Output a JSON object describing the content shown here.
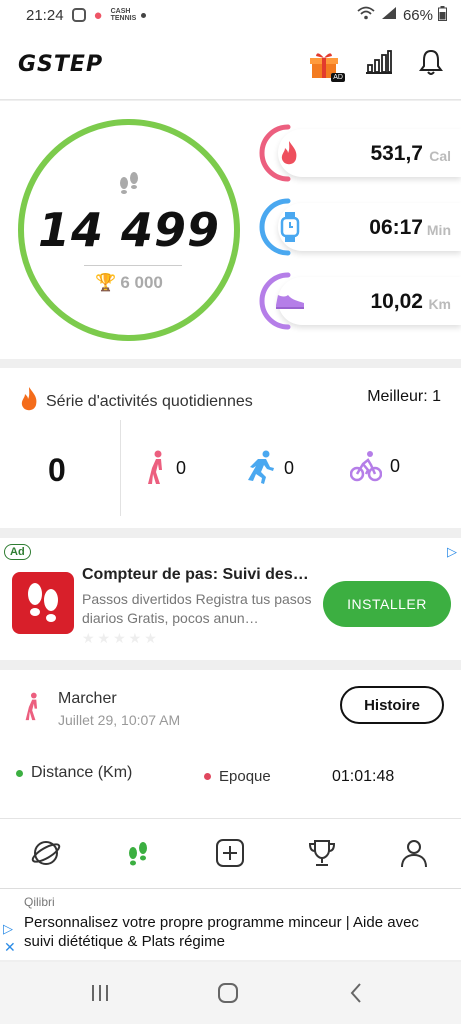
{
  "status_bar": {
    "time": "21:24",
    "cash_badge": "CASH TENNIS",
    "battery": "66%"
  },
  "header": {
    "logo": "GSTEP",
    "gift_badge": "AD",
    "icons": [
      "gift-icon",
      "bar-chart-icon",
      "bell-icon"
    ]
  },
  "steps_card": {
    "steps": "14 499",
    "goal": "6 000",
    "progress_fraction": 1.0,
    "ring_color": "#7ccb4c"
  },
  "stats": [
    {
      "value": "531,7",
      "unit": "Cal",
      "icon": "flame-icon",
      "color": "#ec5f7f"
    },
    {
      "value": "06:17",
      "unit": "Min",
      "icon": "watch-icon",
      "color": "#4aa8f0"
    },
    {
      "value": "10,02",
      "unit": "Km",
      "icon": "shoe-icon",
      "color": "#b57ee8"
    }
  ],
  "streak": {
    "title": "Série d'activités quotidiennes",
    "best": "Meilleur: 1",
    "current": "0",
    "walk": "0",
    "run": "0",
    "bike": "0"
  },
  "ad": {
    "badge": "Ad",
    "title": "Compteur de pas: Suivi des…",
    "desc": "Passos divertidos Registra tus pasos diarios Gratis, pocos anun…",
    "install": "INSTALLER"
  },
  "history": {
    "activity": "Marcher",
    "date": "Juillet 29, 10:07 AM",
    "button": "Histoire",
    "distance_label": "Distance (Km)",
    "epoch_label": "Epoque",
    "epoch_value": "01:01:48"
  },
  "bottom_nav": [
    "planet-icon",
    "footsteps-icon",
    "add-icon",
    "trophy-icon",
    "profile-icon"
  ],
  "banner": {
    "advertiser": "Qilibri",
    "text": "Personnalisez votre propre programme minceur | Aide avec suivi diététique & Plats régime"
  }
}
